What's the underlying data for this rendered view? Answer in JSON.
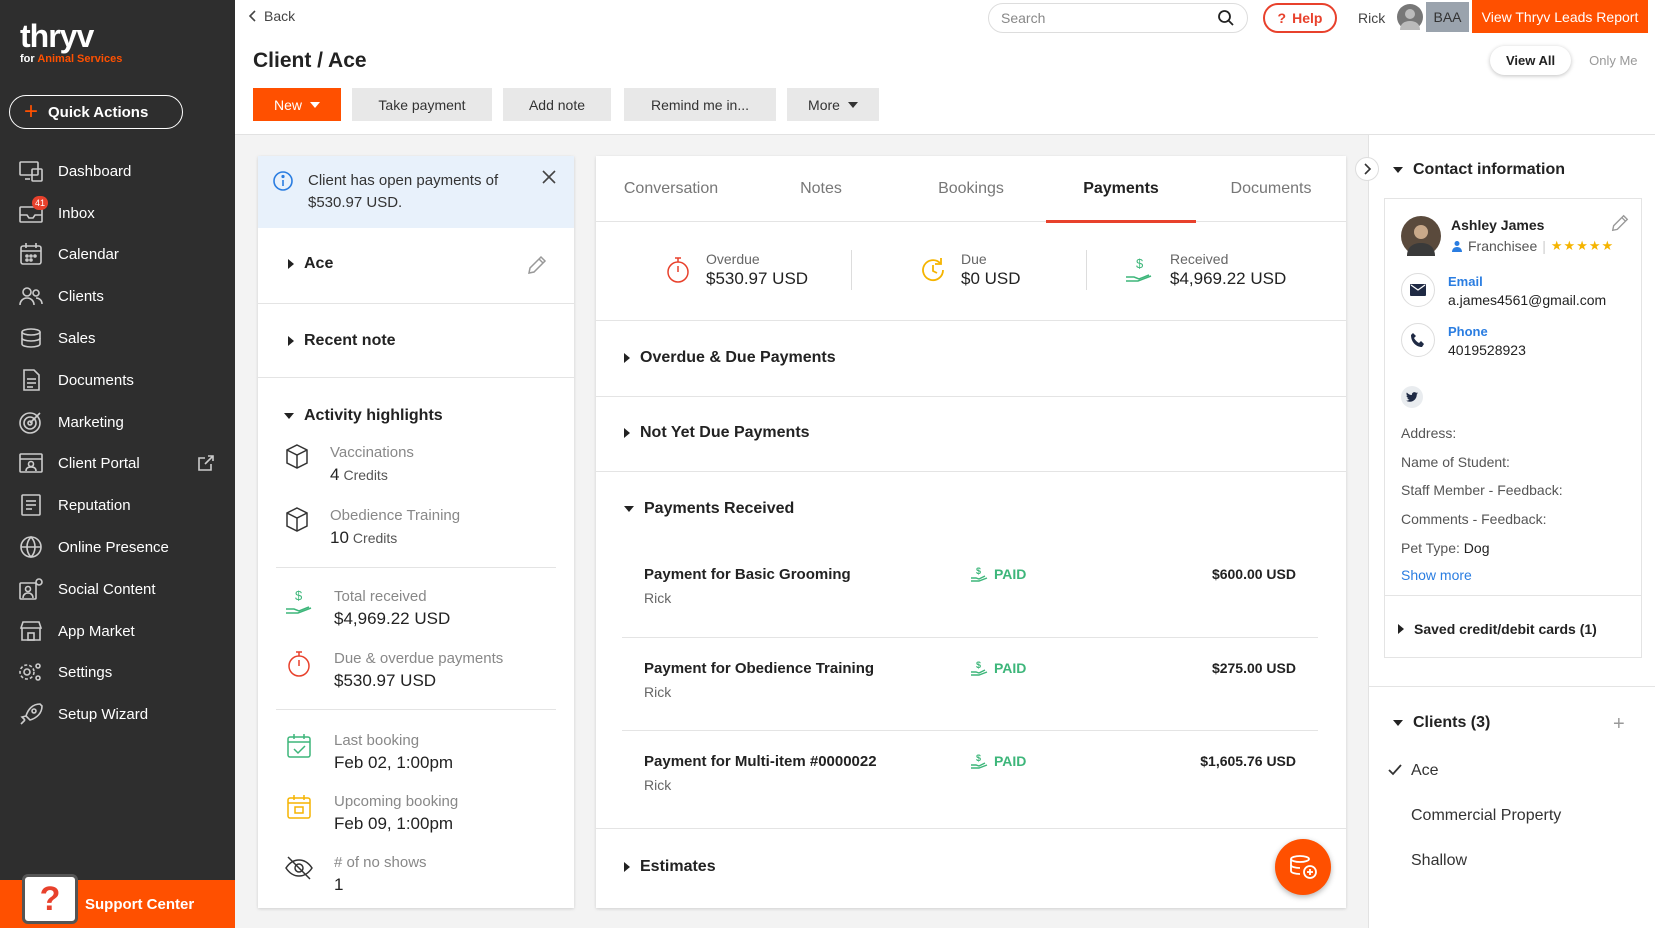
{
  "sidebar": {
    "logo": {
      "main": "thryv",
      "sub_prefix": "for",
      "sub_accent": "Animal Services"
    },
    "quick_actions": "Quick Actions",
    "items": [
      {
        "label": "Dashboard",
        "icon": "dashboard-icon"
      },
      {
        "label": "Inbox",
        "icon": "inbox-icon",
        "badge": "41"
      },
      {
        "label": "Calendar",
        "icon": "calendar-icon"
      },
      {
        "label": "Clients",
        "icon": "clients-icon"
      },
      {
        "label": "Sales",
        "icon": "sales-icon"
      },
      {
        "label": "Documents",
        "icon": "documents-icon"
      },
      {
        "label": "Marketing",
        "icon": "marketing-icon"
      },
      {
        "label": "Client Portal",
        "icon": "client-portal-icon"
      },
      {
        "label": "Reputation",
        "icon": "reputation-icon"
      },
      {
        "label": "Online Presence",
        "icon": "globe-icon"
      },
      {
        "label": "Social Content",
        "icon": "social-content-icon"
      },
      {
        "label": "App Market",
        "icon": "store-icon"
      },
      {
        "label": "Settings",
        "icon": "gear-icon"
      },
      {
        "label": "Setup Wizard",
        "icon": "rocket-icon"
      }
    ],
    "support": "Support Center"
  },
  "topbar": {
    "back": "Back",
    "search_placeholder": "Search",
    "help": "Help",
    "user": "Rick",
    "initials": "BAA",
    "leads_button": "View Thryv Leads Report"
  },
  "header": {
    "title": "Client / Ace",
    "toggle_on": "View All",
    "toggle_off": "Only Me",
    "actions": {
      "new": "New",
      "take_payment": "Take payment",
      "add_note": "Add note",
      "remind": "Remind me in...",
      "more": "More"
    }
  },
  "left": {
    "alert": "Client has open payments of $530.97 USD.",
    "client_name": "Ace",
    "recent_note": "Recent note",
    "activity_title": "Activity highlights",
    "credits": [
      {
        "label": "Vaccinations",
        "count": "4",
        "unit": "Credits"
      },
      {
        "label": "Obedience Training",
        "count": "10",
        "unit": "Credits"
      }
    ],
    "total_received": {
      "label": "Total received",
      "value": "$4,969.22 USD"
    },
    "due_overdue": {
      "label": "Due & overdue payments",
      "value": "$530.97 USD"
    },
    "last_booking": {
      "label": "Last booking",
      "value": "Feb 02, 1:00pm"
    },
    "upcoming_booking": {
      "label": "Upcoming booking",
      "value": "Feb 09, 1:00pm"
    },
    "no_shows": {
      "label": "# of no shows",
      "value": "1"
    }
  },
  "main": {
    "tabs": [
      "Conversation",
      "Notes",
      "Bookings",
      "Payments",
      "Documents"
    ],
    "active_tab": "Payments",
    "stats": {
      "overdue": {
        "label": "Overdue",
        "value": "$530.97 USD"
      },
      "due": {
        "label": "Due",
        "value": "$0 USD"
      },
      "received": {
        "label": "Received",
        "value": "$4,969.22 USD"
      }
    },
    "sections": {
      "overdue_due": "Overdue & Due Payments",
      "not_yet_due": "Not Yet Due Payments",
      "received": "Payments Received",
      "estimates": "Estimates"
    },
    "payments": [
      {
        "title": "Payment for Basic Grooming",
        "user": "Rick",
        "status": "PAID",
        "amount": "$600.00 USD"
      },
      {
        "title": "Payment for Obedience Training",
        "user": "Rick",
        "status": "PAID",
        "amount": "$275.00 USD"
      },
      {
        "title": "Payment for Multi-item #0000022",
        "user": "Rick",
        "status": "PAID",
        "amount": "$1,605.76 USD"
      }
    ]
  },
  "right": {
    "contact_title": "Contact information",
    "contact": {
      "name": "Ashley James",
      "role": "Franchisee",
      "stars": "★★★★★",
      "email_label": "Email",
      "email": "a.james4561@gmail.com",
      "phone_label": "Phone",
      "phone": "4019528923"
    },
    "fields": [
      {
        "label": "Address:",
        "value": ""
      },
      {
        "label": "Name of Student:",
        "value": ""
      },
      {
        "label": "Staff Member - Feedback:",
        "value": ""
      },
      {
        "label": "Comments - Feedback:",
        "value": ""
      },
      {
        "label": "Pet Type:",
        "value": "Dog"
      }
    ],
    "show_more": "Show more",
    "saved_cards": "Saved credit/debit cards (1)",
    "clients_title": "Clients (3)",
    "clients": [
      "Ace",
      "Commercial Property",
      "Shallow"
    ]
  },
  "colors": {
    "accent": "#ff5000",
    "sidebar": "#2e2e2e",
    "paid": "#3db67a",
    "link": "#2a7de1"
  }
}
